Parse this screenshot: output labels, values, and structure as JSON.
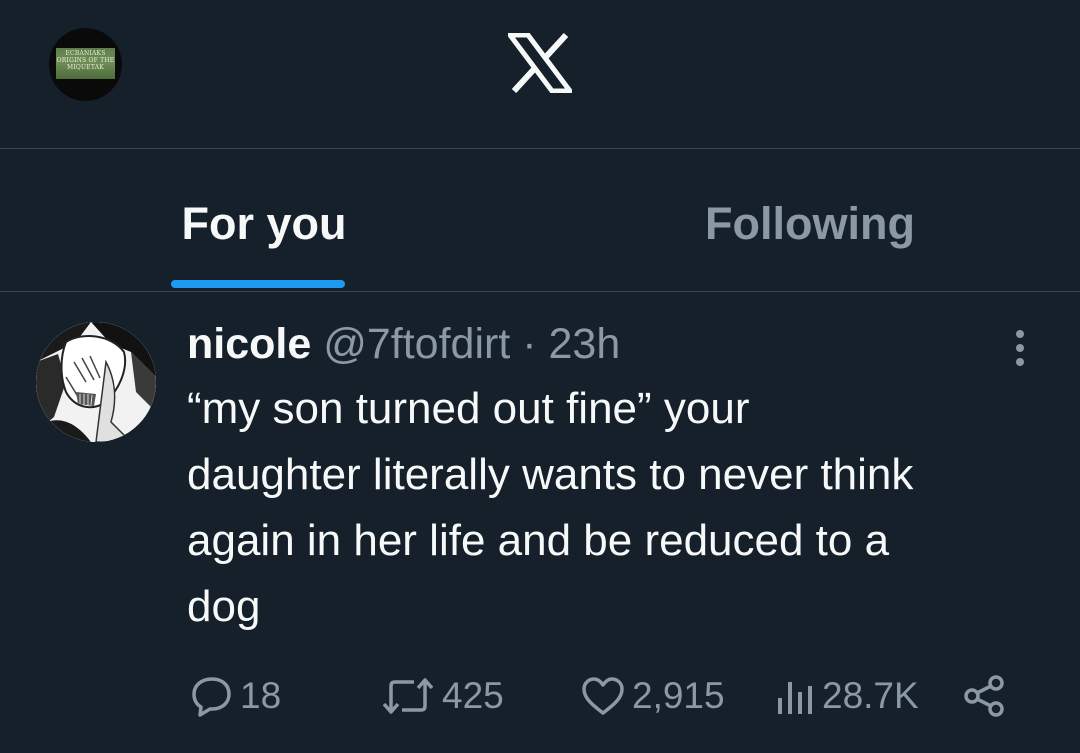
{
  "header": {
    "account_avatar_text": "ECBANIAKS ORIGINS OF THE MIQUETAK",
    "logo": "x-logo"
  },
  "tabs": [
    {
      "label": "For you",
      "selected": true
    },
    {
      "label": "Following",
      "selected": false
    }
  ],
  "colors": {
    "background": "#15202b",
    "accent": "#1d9bf0",
    "text_primary": "#f7f9f9",
    "text_secondary": "#8b98a5",
    "divider": "#38444d"
  },
  "tweet": {
    "author_name": "nicole",
    "author_handle": "@7ftofdirt",
    "separator": "·",
    "time": "23h",
    "text": "“my son turned out fine” your\ndaughter literally wants to never think\nagain in her life and be reduced to a\ndog",
    "actions": {
      "reply_count": "18",
      "repost_count": "425",
      "like_count": "2,915",
      "views_count": "28.7K"
    },
    "icons": {
      "reply": "reply-icon",
      "repost": "repost-icon",
      "like": "heart-icon",
      "views": "views-icon",
      "share": "share-icon",
      "more": "more-icon"
    }
  }
}
